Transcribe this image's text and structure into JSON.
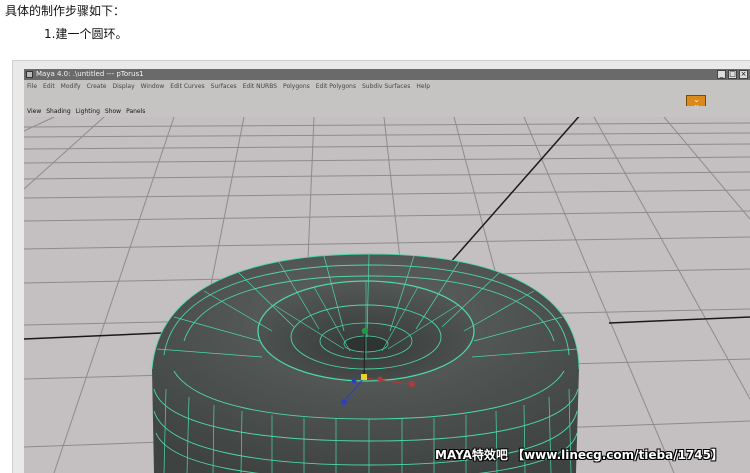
{
  "article": {
    "intro": "具体的制作步骤如下：",
    "step": "1.建一个圆环。"
  },
  "maya": {
    "title": "Maya 4.0: .\\untitled  ---  pTorus1",
    "window_controls": [
      "_",
      "□",
      "×"
    ],
    "main_menu": [
      "File",
      "Edit",
      "Modify",
      "Create",
      "Display",
      "Window",
      "Edit Curves",
      "Surfaces",
      "Edit NURBS",
      "Polygons",
      "Edit Polygons",
      "Subdiv Surfaces",
      "Help"
    ],
    "panel_menu": [
      "View",
      "Shading",
      "Lighting",
      "Show",
      "Panels"
    ],
    "shelf_icon": "chevron-down-icon",
    "colors": {
      "viewport_bg": "#c4bfc0",
      "grid_line": "#8f8b8c",
      "grid_axis": "#1a1a1a",
      "torus_fill": "#4c504f",
      "wireframe": "#4dd9a4"
    }
  },
  "watermark": "MAYA特效吧 【www.linecg.com/tieba/1745】"
}
